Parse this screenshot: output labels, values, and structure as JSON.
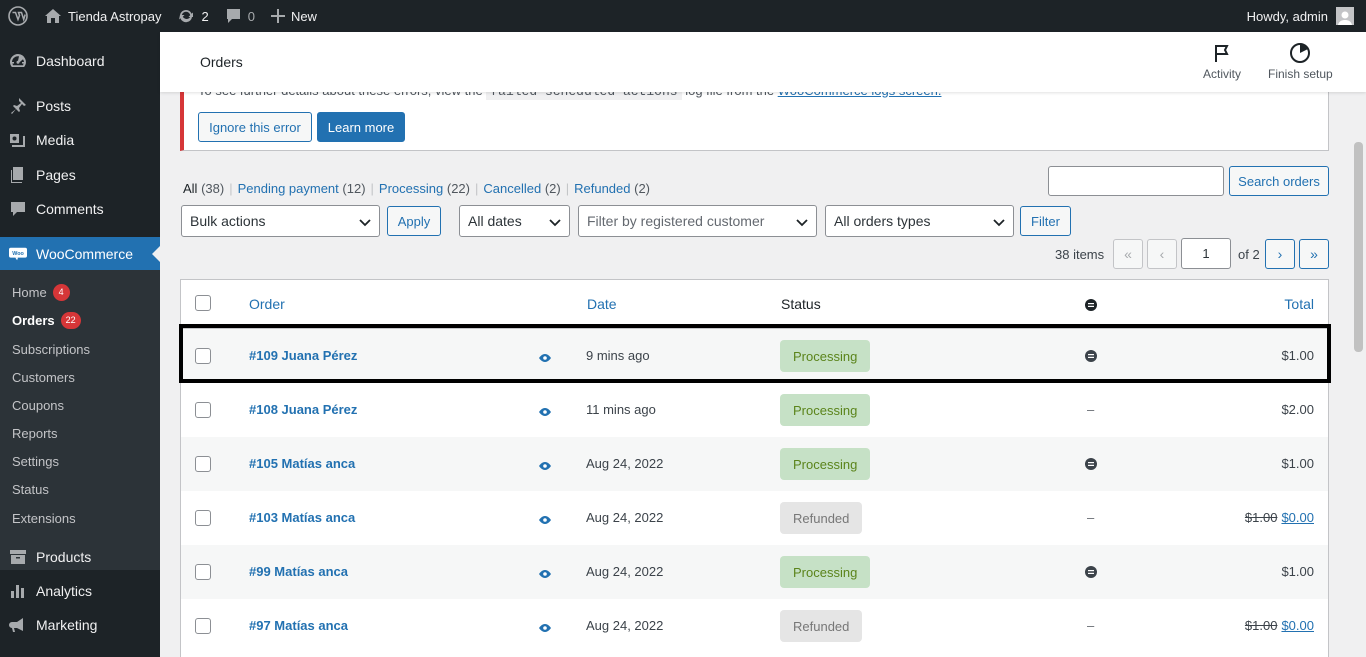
{
  "adminbar": {
    "site_name": "Tienda Astropay",
    "updates_count": "2",
    "comments_count": "0",
    "new_label": "New",
    "howdy": "Howdy, admin"
  },
  "sidebar": {
    "dashboard": "Dashboard",
    "posts": "Posts",
    "media": "Media",
    "pages": "Pages",
    "comments": "Comments",
    "woocommerce": "WooCommerce",
    "products": "Products",
    "analytics": "Analytics",
    "marketing": "Marketing",
    "submenu": {
      "home": "Home",
      "home_badge": "4",
      "orders": "Orders",
      "orders_badge": "22",
      "subscriptions": "Subscriptions",
      "customers": "Customers",
      "coupons": "Coupons",
      "reports": "Reports",
      "settings": "Settings",
      "status": "Status",
      "extensions": "Extensions"
    }
  },
  "header": {
    "title": "Orders",
    "activity": "Activity",
    "finish_setup": "Finish setup"
  },
  "notice": {
    "text_before": "To see further details about these errors, view the",
    "code": "failed-scheduled-actions",
    "text_middle": "log file from the",
    "link": "WooCommerce logs screen.",
    "ignore_button": "Ignore this error",
    "learn_button": "Learn more"
  },
  "views": {
    "all": "All",
    "all_count": "(38)",
    "pending": "Pending payment",
    "pending_count": "(12)",
    "processing": "Processing",
    "processing_count": "(22)",
    "cancelled": "Cancelled",
    "cancelled_count": "(2)",
    "refunded": "Refunded",
    "refunded_count": "(2)"
  },
  "search": {
    "button": "Search orders",
    "value": ""
  },
  "filters": {
    "bulk_actions": "Bulk actions",
    "apply": "Apply",
    "dates": "All dates",
    "customer_placeholder": "Filter by registered customer",
    "order_types": "All orders types",
    "filter": "Filter"
  },
  "pagination": {
    "items": "38 items",
    "first": "«",
    "prev": "‹",
    "current": "1",
    "of": "of 2",
    "next": "›",
    "last": "»"
  },
  "table": {
    "headers": {
      "order": "Order",
      "date": "Date",
      "status": "Status",
      "total": "Total"
    },
    "rows": [
      {
        "order": "#109 Juana Pérez",
        "date": "9 mins ago",
        "status": "Processing",
        "origin": "icon",
        "total": "$1.00",
        "old_total": ""
      },
      {
        "order": "#108 Juana Pérez",
        "date": "11 mins ago",
        "status": "Processing",
        "origin": "–",
        "total": "$2.00",
        "old_total": ""
      },
      {
        "order": "#105 Matías anca",
        "date": "Aug 24, 2022",
        "status": "Processing",
        "origin": "icon",
        "total": "$1.00",
        "old_total": ""
      },
      {
        "order": "#103 Matías anca",
        "date": "Aug 24, 2022",
        "status": "Refunded",
        "origin": "–",
        "total": "$0.00",
        "old_total": "$1.00"
      },
      {
        "order": "#99 Matías anca",
        "date": "Aug 24, 2022",
        "status": "Processing",
        "origin": "icon",
        "total": "$1.00",
        "old_total": ""
      },
      {
        "order": "#97 Matías anca",
        "date": "Aug 24, 2022",
        "status": "Refunded",
        "origin": "–",
        "total": "$0.00",
        "old_total": "$1.00"
      }
    ]
  },
  "colors": {
    "wp_blue": "#2271b1",
    "admin_dark": "#1d2327",
    "processing_bg": "#c6e1c6",
    "processing_fg": "#5b841b",
    "refunded_bg": "#e5e5e5",
    "error_red": "#d63638"
  }
}
